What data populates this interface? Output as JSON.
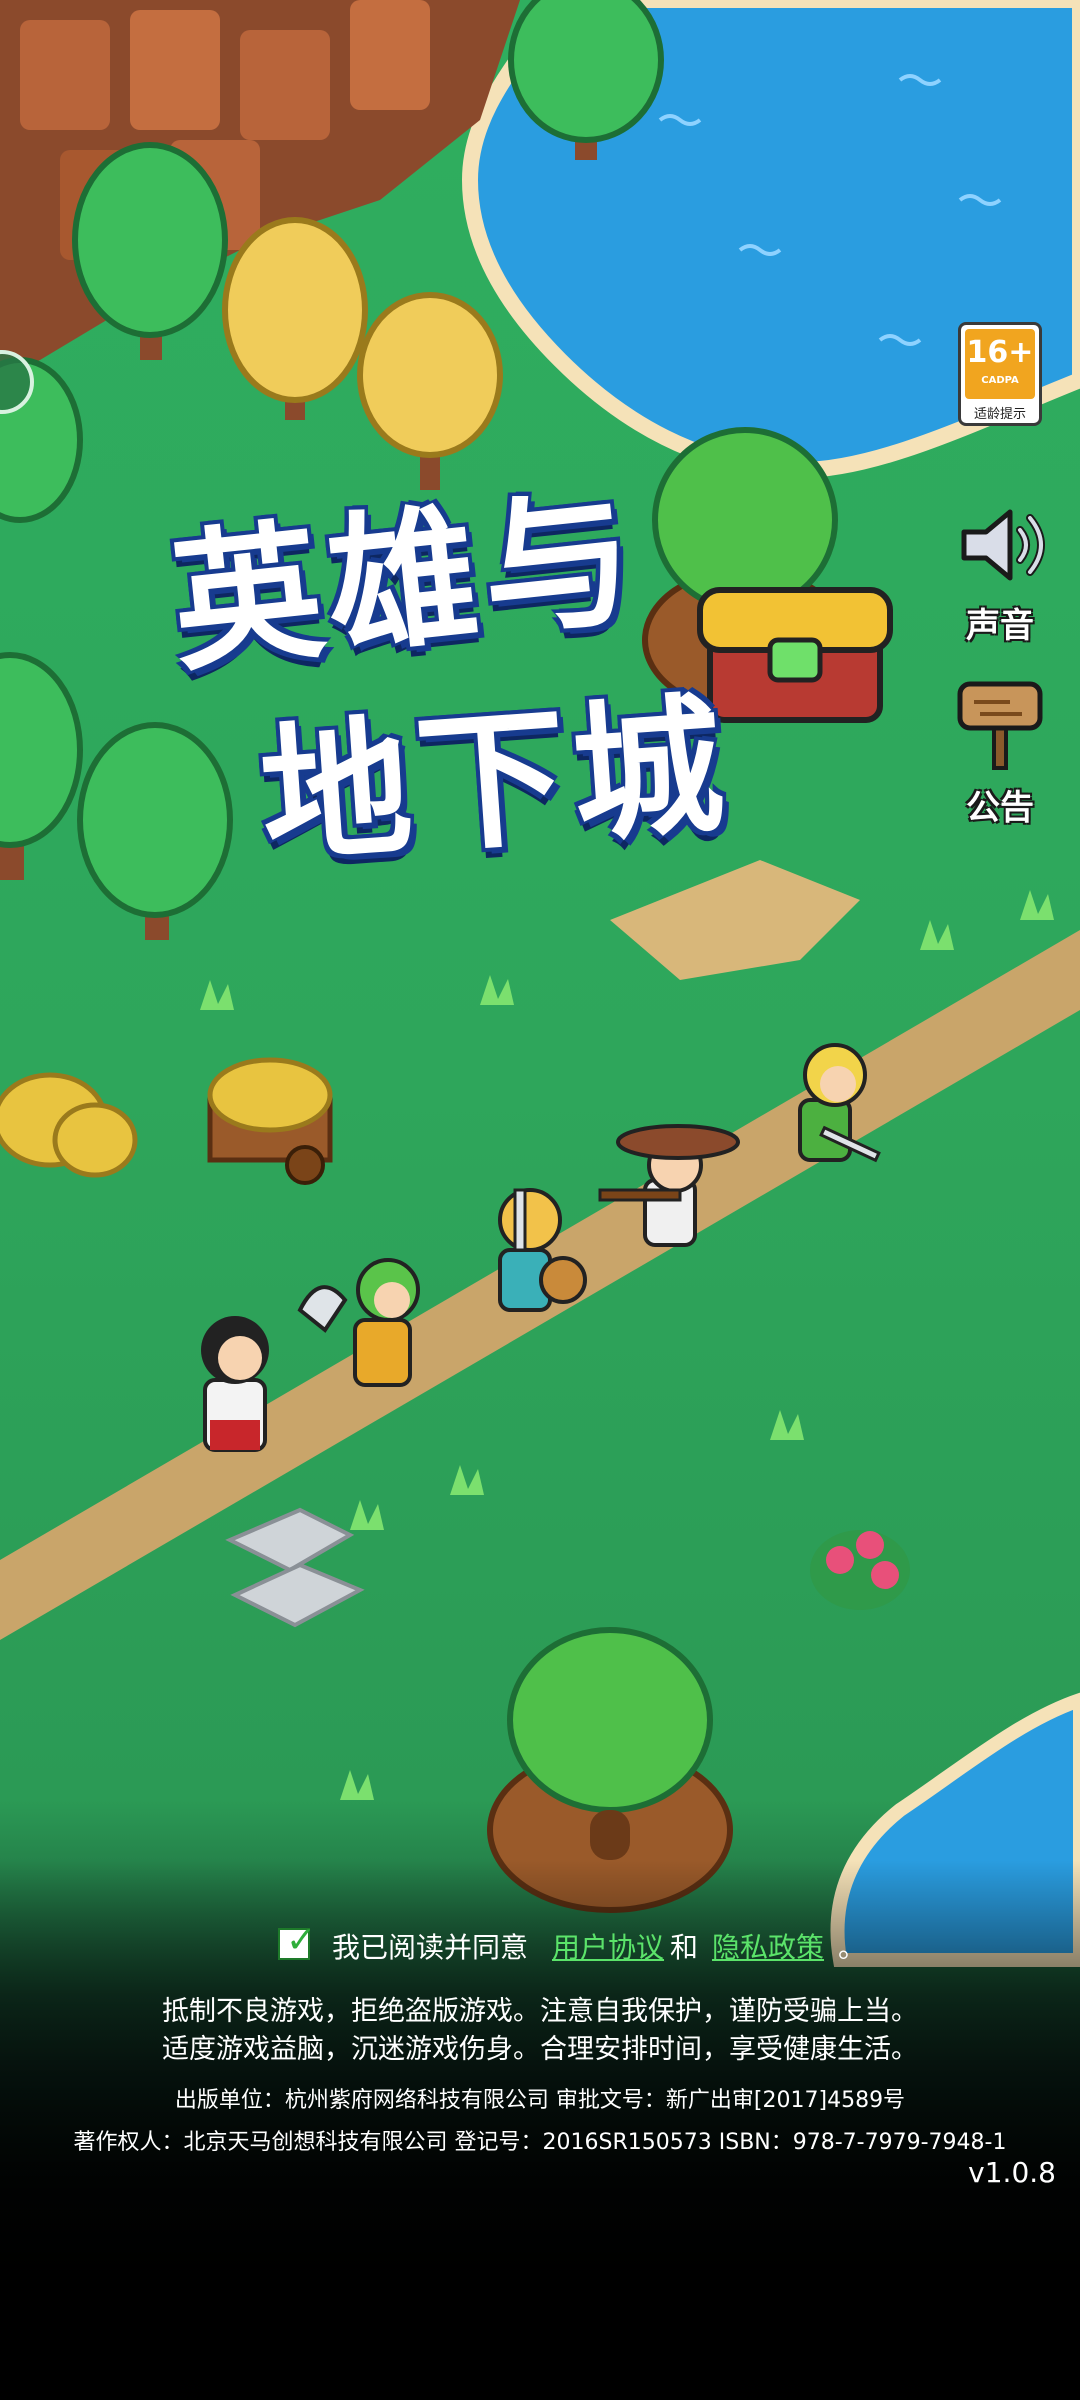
{
  "title": {
    "line1": "英雄与",
    "line2": "地下城"
  },
  "age_rating": {
    "number": "16+",
    "org": "CADPA",
    "hint": "适龄提示"
  },
  "side_buttons": {
    "sound_label": "声音",
    "notice_label": "公告"
  },
  "agreement": {
    "checked": true,
    "prefix": "我已阅读并同意",
    "user_agreement": "用户协议",
    "and": "和",
    "privacy_policy": "隐私政策",
    "suffix": "。"
  },
  "health_notice": {
    "line1": "抵制不良游戏，拒绝盗版游戏。注意自我保护，谨防受骗上当。",
    "line2": "适度游戏益脑，沉迷游戏伤身。合理安排时间，享受健康生活。"
  },
  "publisher": {
    "text": "出版单位：杭州紫府网络科技有限公司      审批文号：新广出审[2017]4589号"
  },
  "copyright": {
    "text": "著作权人：北京天马创想科技有限公司      登记号：2016SR150573   ISBN：978-7-7979-7948-1"
  },
  "version": "v1.0.8",
  "colors": {
    "grass": "#2fae5f",
    "water": "#2a9de0",
    "path": "#c9a56a",
    "link": "#5be36a",
    "title_outline": "#173b8f"
  }
}
